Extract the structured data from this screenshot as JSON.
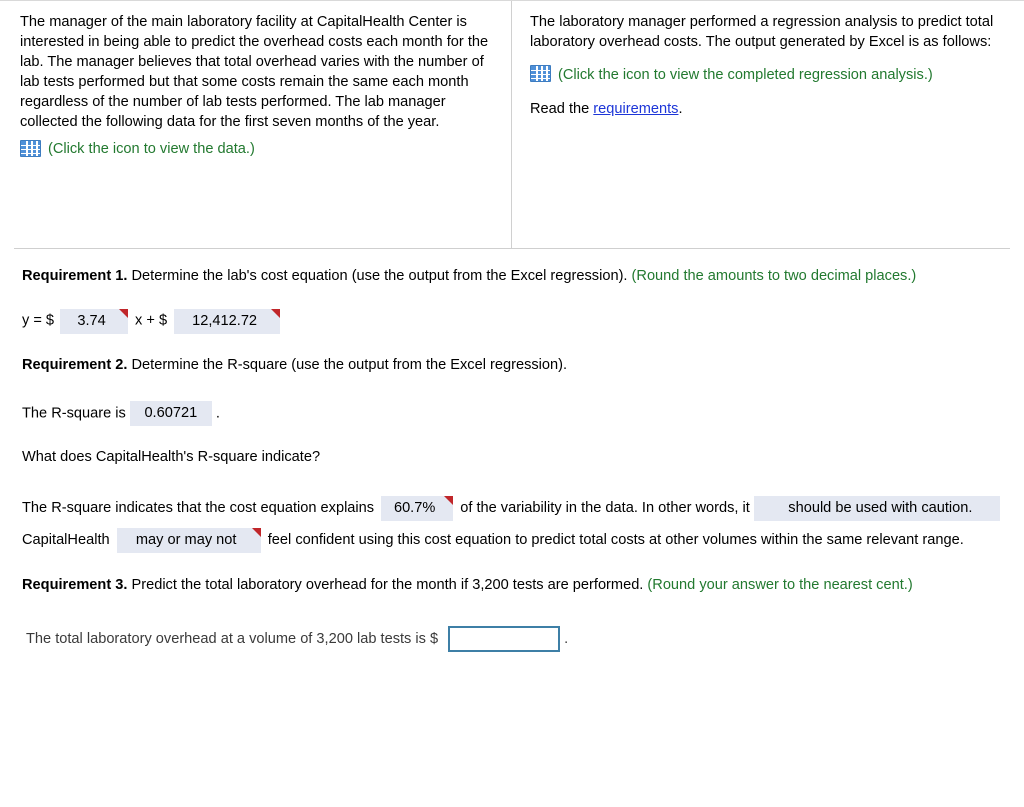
{
  "problem": {
    "left_panel": {
      "text": "The manager of the main laboratory facility at CapitalHealth Center is interested in being able to predict the overhead costs each month for the lab. The manager believes that total overhead varies with the number of lab tests performed but that some costs remain the same each month regardless of the number of lab tests performed. The lab manager collected the following data for the first seven months of the year.",
      "icon_name": "table-grid-icon",
      "icon_link_text": "(Click the icon to view the data.)"
    },
    "right_panel": {
      "text": "The laboratory manager performed a regression analysis to predict total laboratory overhead costs. The output generated by Excel is as follows:",
      "icon_name": "table-grid-icon",
      "icon_link_text": "(Click the icon to view the completed regression analysis.)",
      "read_prefix": "Read the ",
      "link_text": "requirements",
      "read_suffix": "."
    }
  },
  "requirement1": {
    "label": "Requirement 1.",
    "prompt": " Determine the lab's cost equation (use the output from the Excel regression). ",
    "hint": "(Round the amounts to two decimal places.)",
    "equation": {
      "prefix": "y = $",
      "slope_value": "3.74",
      "middle": "x + $",
      "intercept_value": "12,412.72"
    }
  },
  "requirement2": {
    "label": "Requirement 2.",
    "prompt": " Determine the R-square (use the output from the Excel regression).",
    "rsquare_prefix": "The R-square is",
    "rsquare_value": "0.60721",
    "rsquare_suffix": ".",
    "question": "What does CapitalHealth's R-square indicate?",
    "indicate": {
      "part1": "The R-square indicates that the cost equation explains",
      "percent_value": "60.7%",
      "part2": "of the variability in the data. In other words, it",
      "caution_value": "should be used with caution.",
      "part3": "CapitalHealth",
      "mayornot_value": "may or may not",
      "part4": "feel confident using this cost equation to predict total costs at other volumes within the same relevant range."
    }
  },
  "requirement3": {
    "label": "Requirement 3.",
    "prompt": " Predict the total laboratory overhead for the month if 3,200 tests are performed. ",
    "hint": "(Round your answer to the nearest cent.)",
    "answer_prefix": "The total laboratory overhead at a volume of 3,200 lab tests is $",
    "answer_value": "",
    "answer_suffix": "."
  },
  "colors": {
    "green": "#22792f",
    "link_blue": "#1d36d8",
    "field_bg": "#e4e8f2",
    "flag_red": "#c0262a",
    "input_border": "#3d7fa6",
    "icon_blue": "#4f90d8"
  }
}
